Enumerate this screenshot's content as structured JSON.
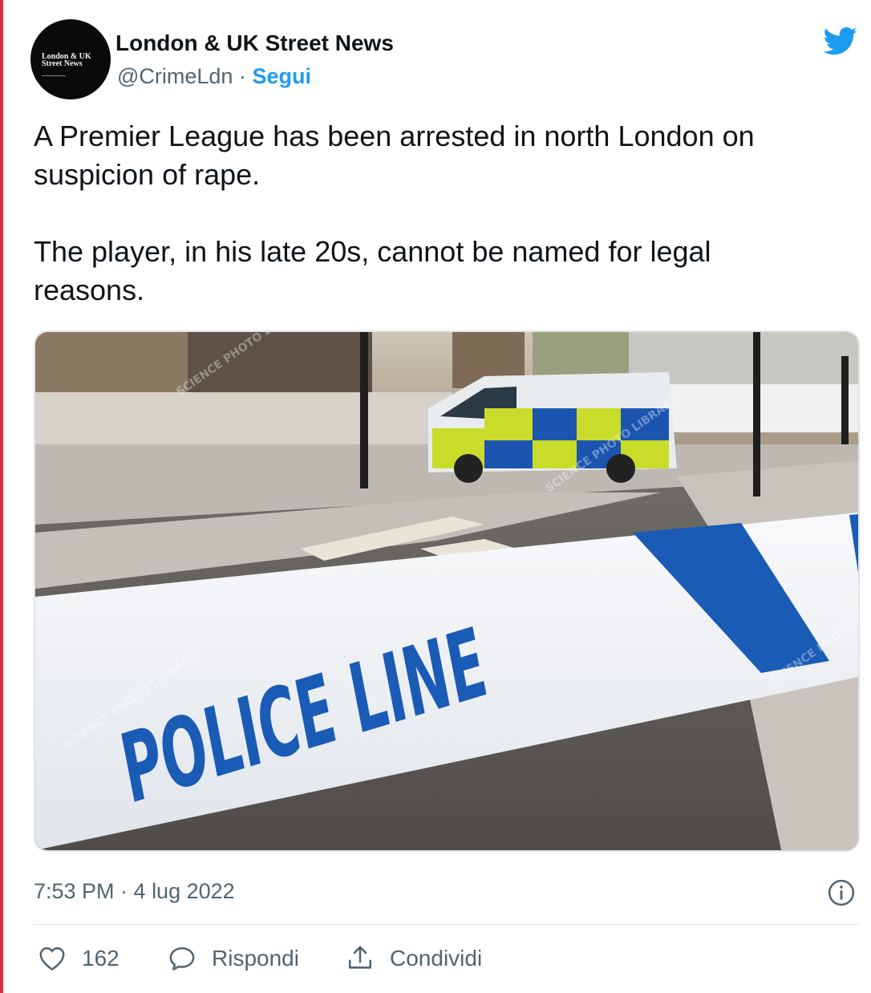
{
  "author": {
    "name": "London & UK Street News",
    "handle": "@CrimeLdn",
    "separator": " · ",
    "follow_label": "Segui",
    "avatar_logo_text": "London & UK Street News"
  },
  "tweet": {
    "text": "A Premier League has been arrested in north London on\nsuspicion of rape.\n\nThe player, in his late 20s, cannot be named for legal\nreasons.",
    "timestamp": "7:53 PM · 4 lug 2022"
  },
  "media": {
    "tape_text": "POLICE LINE",
    "watermark": "SCIENCE PHOTO LIBRARY"
  },
  "actions": {
    "like_count": "162",
    "reply_label": "Rispondi",
    "share_label": "Condividi"
  },
  "colors": {
    "accent": "#1d9bf0",
    "text": "#0f1419",
    "secondary": "#536471",
    "tape_blue": "#1a5bb5"
  },
  "icons": [
    "twitter-bird-icon",
    "info-icon",
    "heart-icon",
    "reply-bubble-icon",
    "share-icon"
  ]
}
